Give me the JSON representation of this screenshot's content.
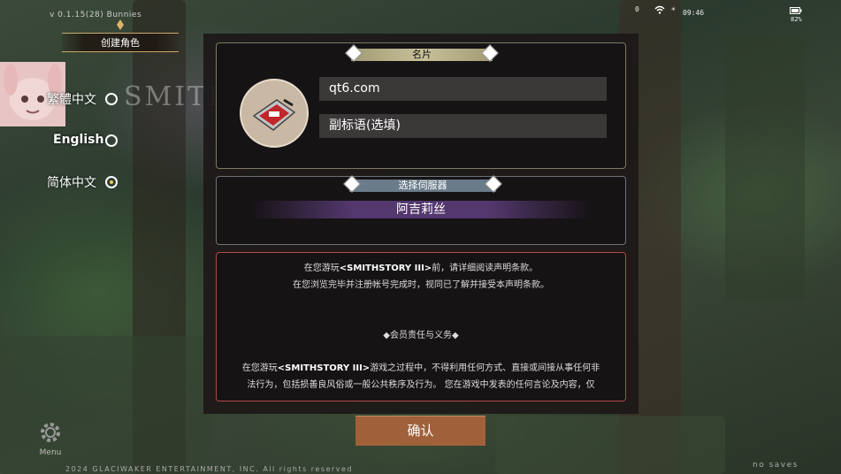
{
  "version": "v 0.1.15(28) Bunnies",
  "status": {
    "signal": "0",
    "time": "09:46",
    "battery": "82%"
  },
  "title": "创建角色",
  "game_logo_bg": "SMITH S",
  "languages": [
    {
      "label": "繁體中文",
      "selected": false
    },
    {
      "label": "English",
      "selected": false
    },
    {
      "label": "简体中文",
      "selected": true
    }
  ],
  "card": {
    "header": "名片",
    "name_value": "qt6.com",
    "subtitle_placeholder": "副标语(选填)"
  },
  "server": {
    "header": "选择伺服器",
    "value": "阿吉莉丝"
  },
  "terms": {
    "line1_pre": "在您游玩",
    "game_name": "<SMITHSTORY III>",
    "line1_post": "前，请详细阅读声明条款。",
    "line2": "在您浏览完毕并注册帐号完成时，视同已了解并接受本声明条款。",
    "section": "◆会员责任与义务◆",
    "line3_pre": "在您游玩",
    "line3_post": "游戏之过程中，不得利用任何方式、直接或间接从事任何非",
    "line4": "法行为，包括损善良风俗或一般公共秩序及行为。 您在游戏中发表的任何言论及内容，仅"
  },
  "confirm_label": "确认",
  "menu_label": "Menu",
  "copyright": "2024 GLACIWAKER ENTERTAINMENT, INC. All rights reserved",
  "saves_label": "no saves",
  "colors": {
    "confirm": "#a0603a",
    "server_bar": "#5a3c78",
    "terms_border": "#b34a45"
  }
}
